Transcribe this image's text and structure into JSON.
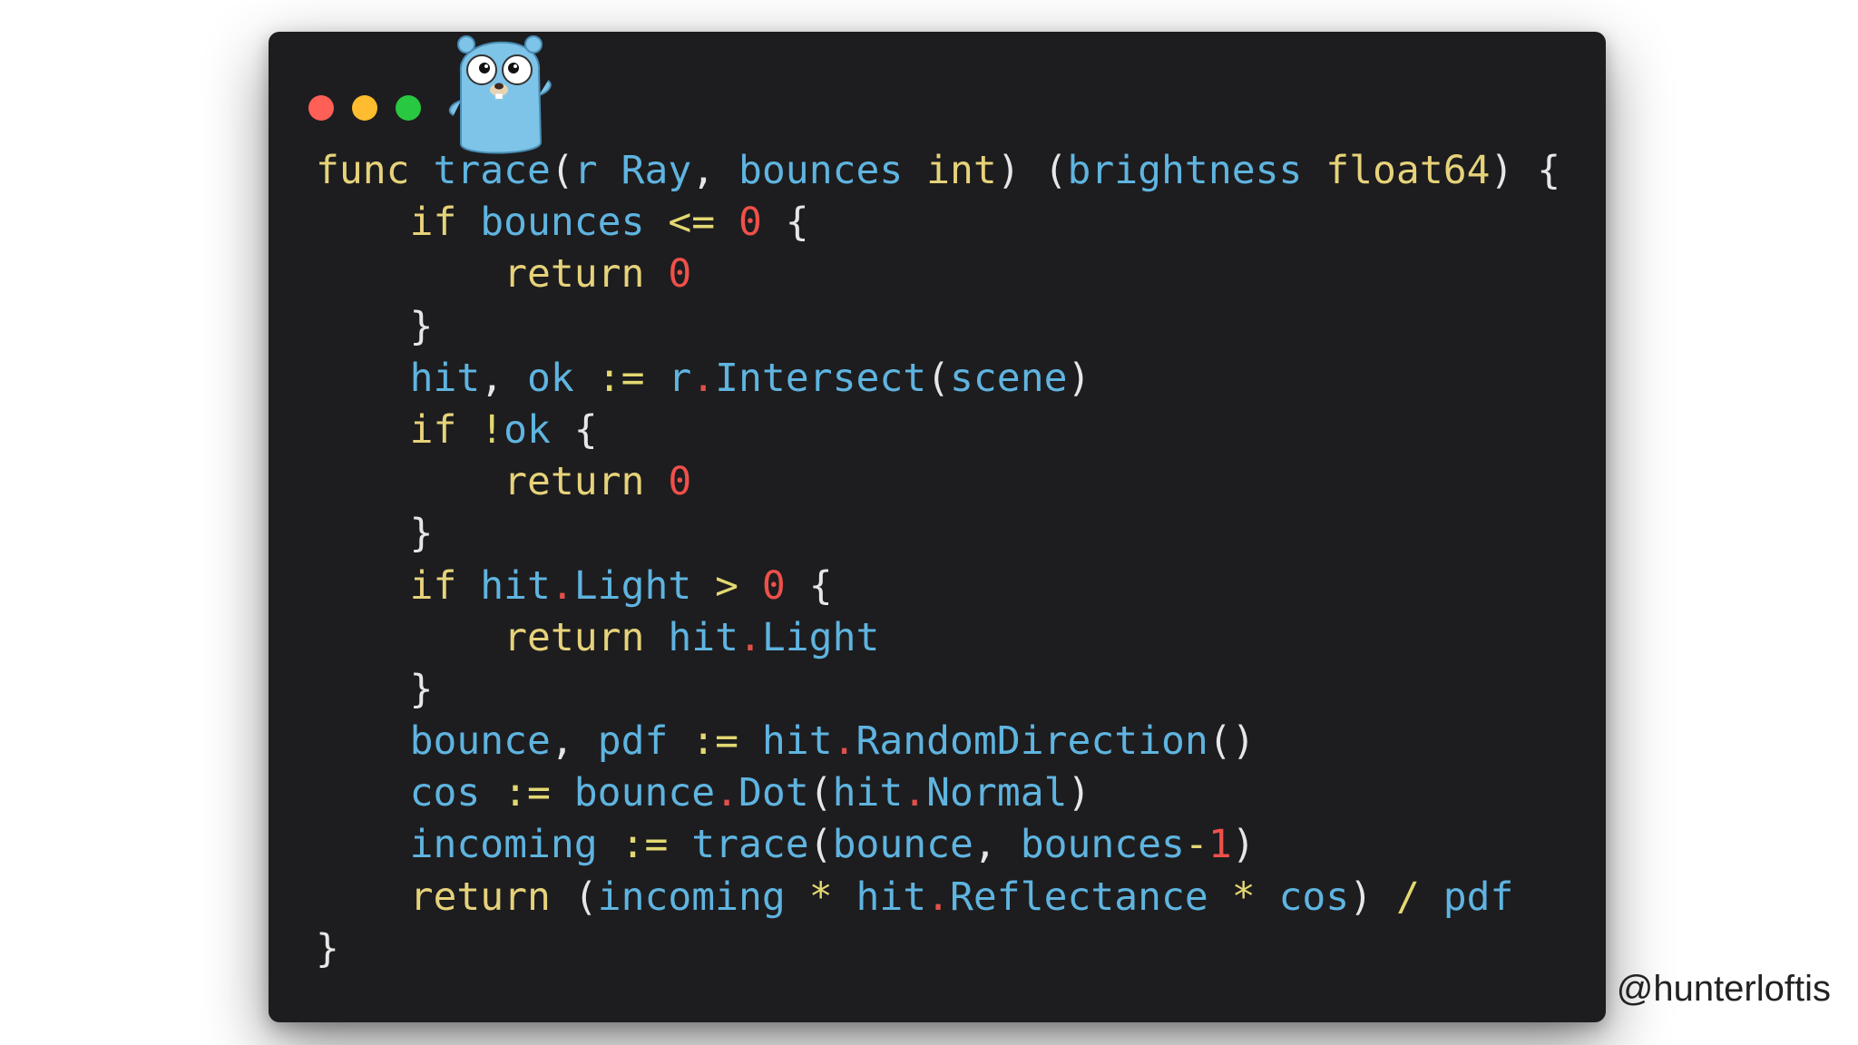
{
  "window": {
    "controls": [
      {
        "name": "close",
        "color": "#fe5f57"
      },
      {
        "name": "minimize",
        "color": "#febc2e"
      },
      {
        "name": "maximize",
        "color": "#28c840"
      }
    ],
    "mascot_icon": "go-gopher-icon"
  },
  "code": {
    "language": "go",
    "lines": [
      [
        [
          "kw",
          "func"
        ],
        [
          "pun",
          " "
        ],
        [
          "id",
          "trace"
        ],
        [
          "pun",
          "("
        ],
        [
          "id",
          "r"
        ],
        [
          "pun",
          " "
        ],
        [
          "id",
          "Ray"
        ],
        [
          "pun",
          ", "
        ],
        [
          "id",
          "bounces"
        ],
        [
          "pun",
          " "
        ],
        [
          "kw",
          "int"
        ],
        [
          "pun",
          ") ("
        ],
        [
          "id",
          "brightness"
        ],
        [
          "pun",
          " "
        ],
        [
          "kw",
          "float64"
        ],
        [
          "pun",
          ") {"
        ]
      ],
      [
        [
          "pun",
          "    "
        ],
        [
          "kw",
          "if"
        ],
        [
          "pun",
          " "
        ],
        [
          "id",
          "bounces"
        ],
        [
          "pun",
          " "
        ],
        [
          "op",
          "<="
        ],
        [
          "pun",
          " "
        ],
        [
          "num",
          "0"
        ],
        [
          "pun",
          " {"
        ]
      ],
      [
        [
          "pun",
          "        "
        ],
        [
          "kw",
          "return"
        ],
        [
          "pun",
          " "
        ],
        [
          "num",
          "0"
        ]
      ],
      [
        [
          "pun",
          "    }"
        ]
      ],
      [
        [
          "pun",
          "    "
        ],
        [
          "id",
          "hit"
        ],
        [
          "pun",
          ", "
        ],
        [
          "id",
          "ok"
        ],
        [
          "pun",
          " "
        ],
        [
          "op",
          ":="
        ],
        [
          "pun",
          " "
        ],
        [
          "id",
          "r"
        ],
        [
          "dotop",
          "."
        ],
        [
          "id",
          "Intersect"
        ],
        [
          "pun",
          "("
        ],
        [
          "id",
          "scene"
        ],
        [
          "pun",
          ")"
        ]
      ],
      [
        [
          "pun",
          "    "
        ],
        [
          "kw",
          "if"
        ],
        [
          "pun",
          " "
        ],
        [
          "op",
          "!"
        ],
        [
          "id",
          "ok"
        ],
        [
          "pun",
          " {"
        ]
      ],
      [
        [
          "pun",
          "        "
        ],
        [
          "kw",
          "return"
        ],
        [
          "pun",
          " "
        ],
        [
          "num",
          "0"
        ]
      ],
      [
        [
          "pun",
          "    }"
        ]
      ],
      [
        [
          "pun",
          "    "
        ],
        [
          "kw",
          "if"
        ],
        [
          "pun",
          " "
        ],
        [
          "id",
          "hit"
        ],
        [
          "dotop",
          "."
        ],
        [
          "id",
          "Light"
        ],
        [
          "pun",
          " "
        ],
        [
          "op",
          ">"
        ],
        [
          "pun",
          " "
        ],
        [
          "num",
          "0"
        ],
        [
          "pun",
          " {"
        ]
      ],
      [
        [
          "pun",
          "        "
        ],
        [
          "kw",
          "return"
        ],
        [
          "pun",
          " "
        ],
        [
          "id",
          "hit"
        ],
        [
          "dotop",
          "."
        ],
        [
          "id",
          "Light"
        ]
      ],
      [
        [
          "pun",
          "    }"
        ]
      ],
      [
        [
          "pun",
          "    "
        ],
        [
          "id",
          "bounce"
        ],
        [
          "pun",
          ", "
        ],
        [
          "id",
          "pdf"
        ],
        [
          "pun",
          " "
        ],
        [
          "op",
          ":="
        ],
        [
          "pun",
          " "
        ],
        [
          "id",
          "hit"
        ],
        [
          "dotop",
          "."
        ],
        [
          "id",
          "RandomDirection"
        ],
        [
          "pun",
          "()"
        ]
      ],
      [
        [
          "pun",
          "    "
        ],
        [
          "id",
          "cos"
        ],
        [
          "pun",
          " "
        ],
        [
          "op",
          ":="
        ],
        [
          "pun",
          " "
        ],
        [
          "id",
          "bounce"
        ],
        [
          "dotop",
          "."
        ],
        [
          "id",
          "Dot"
        ],
        [
          "pun",
          "("
        ],
        [
          "id",
          "hit"
        ],
        [
          "dotop",
          "."
        ],
        [
          "id",
          "Normal"
        ],
        [
          "pun",
          ")"
        ]
      ],
      [
        [
          "pun",
          "    "
        ],
        [
          "id",
          "incoming"
        ],
        [
          "pun",
          " "
        ],
        [
          "op",
          ":="
        ],
        [
          "pun",
          " "
        ],
        [
          "id",
          "trace"
        ],
        [
          "pun",
          "("
        ],
        [
          "id",
          "bounce"
        ],
        [
          "pun",
          ", "
        ],
        [
          "id",
          "bounces"
        ],
        [
          "op",
          "-"
        ],
        [
          "num",
          "1"
        ],
        [
          "pun",
          ")"
        ]
      ],
      [
        [
          "pun",
          "    "
        ],
        [
          "kw",
          "return"
        ],
        [
          "pun",
          " ("
        ],
        [
          "id",
          "incoming"
        ],
        [
          "pun",
          " "
        ],
        [
          "op",
          "*"
        ],
        [
          "pun",
          " "
        ],
        [
          "id",
          "hit"
        ],
        [
          "dotop",
          "."
        ],
        [
          "id",
          "Reflectance"
        ],
        [
          "pun",
          " "
        ],
        [
          "op",
          "*"
        ],
        [
          "pun",
          " "
        ],
        [
          "id",
          "cos"
        ],
        [
          "pun",
          ") "
        ],
        [
          "op",
          "/"
        ],
        [
          "pun",
          " "
        ],
        [
          "id",
          "pdf"
        ]
      ],
      [
        [
          "pun",
          "}"
        ]
      ]
    ]
  },
  "footer": {
    "handle": "@hunterloftis"
  }
}
